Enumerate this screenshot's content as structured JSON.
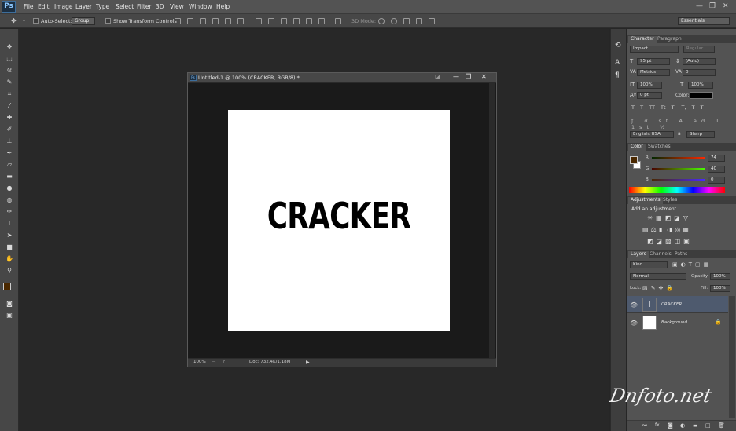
{
  "app": {
    "logo": "Ps"
  },
  "menu": [
    "File",
    "Edit",
    "Image",
    "Layer",
    "Type",
    "Select",
    "Filter",
    "3D",
    "View",
    "Window",
    "Help"
  ],
  "window_controls": {
    "minimize": "—",
    "restore": "❐",
    "close": "✕"
  },
  "options_bar": {
    "auto_select_label": "Auto-Select:",
    "auto_select_value": "Group",
    "transform_label": "Show Transform Controls",
    "mode_3d_label": "3D Mode:",
    "workspace": "Essentials"
  },
  "document": {
    "title": "Untitled-1 @ 100% (CRACKER, RGB/8) *",
    "canvas_text": "CRACKER",
    "zoom": "100%",
    "doc_size": "Doc: 732.4K/1.18M"
  },
  "character_panel": {
    "tabs": [
      "Character",
      "Paragraph"
    ],
    "font": "Impact",
    "style": "Regular",
    "size": "95 pt",
    "leading": "(Auto)",
    "kerning": "Metrics",
    "tracking": "0",
    "vscale": "100%",
    "hscale": "100%",
    "baseline": "0 pt",
    "color_label": "Color:",
    "style_buttons": [
      "T",
      "T",
      "TT",
      "Tt",
      "T'",
      "T,",
      "T",
      "T"
    ],
    "language": "English: USA",
    "aa_prefix": "a",
    "aa": "Sharp"
  },
  "color_panel": {
    "tabs": [
      "Color",
      "Swatches"
    ],
    "r_label": "R",
    "r": "74",
    "g_label": "G",
    "g": "40",
    "b_label": "B",
    "b": "0",
    "fg_color": "#4a2800"
  },
  "adjustments_panel": {
    "tabs": [
      "Adjustments",
      "Styles"
    ],
    "heading": "Add an adjustment"
  },
  "layers_panel": {
    "tabs": [
      "Layers",
      "Channels",
      "Paths"
    ],
    "filter": "Kind",
    "blend_mode": "Normal",
    "opacity_label": "Opacity:",
    "opacity": "100%",
    "lock_label": "Lock:",
    "fill_label": "Fill:",
    "fill": "100%",
    "layers": [
      {
        "name": "CRACKER",
        "type_glyph": "T"
      },
      {
        "name": "Background"
      }
    ],
    "bottom_icons": [
      "link-icon",
      "fx-icon",
      "mask-icon",
      "adjustment-icon",
      "folder-icon",
      "new-layer-icon",
      "trash-icon"
    ]
  },
  "watermark": "Dnfoto.net",
  "colors": {
    "bg": "#262626",
    "panel": "#535353",
    "accent": "#3d6e9c"
  }
}
